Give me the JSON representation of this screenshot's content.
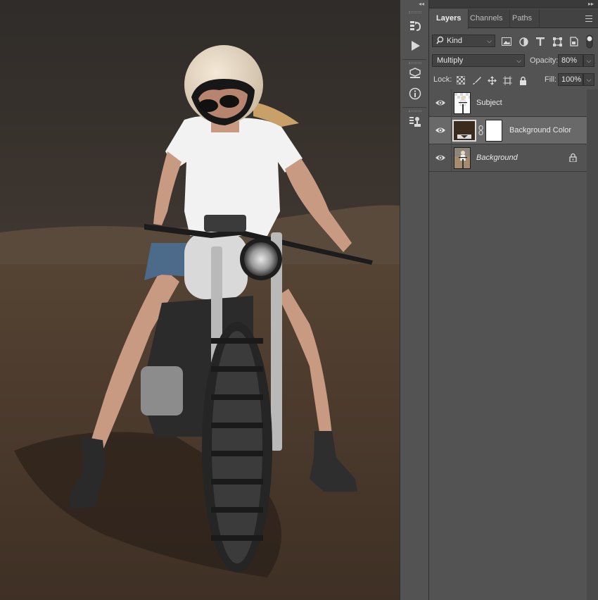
{
  "panel": {
    "tabs": [
      {
        "label": "Layers",
        "active": true
      },
      {
        "label": "Channels",
        "active": false
      },
      {
        "label": "Paths",
        "active": false
      }
    ],
    "filter_kind": "Kind",
    "blend_mode": "Multiply",
    "opacity_label": "Opacity:",
    "opacity_value": "80%",
    "lock_label": "Lock:",
    "fill_label": "Fill:",
    "fill_value": "100%"
  },
  "layers": [
    {
      "name": "Subject",
      "visible": true,
      "selected": false,
      "italic": false,
      "locked": false
    },
    {
      "name": "Background Color",
      "visible": true,
      "selected": true,
      "italic": false,
      "locked": false,
      "fill_color": "#3b2a1e",
      "has_mask": true
    },
    {
      "name": "Background",
      "visible": true,
      "selected": false,
      "italic": true,
      "locked": true
    }
  ],
  "colors": {
    "panel_bg": "#535353",
    "selected_row": "#696969",
    "canvas_ground": "#4a3a2c",
    "canvas_sky": "#3a3430"
  },
  "toolstrip_icons": [
    "history-icon",
    "play-action-icon",
    "3d-cube-icon",
    "info-icon",
    "clone-source-icon"
  ]
}
